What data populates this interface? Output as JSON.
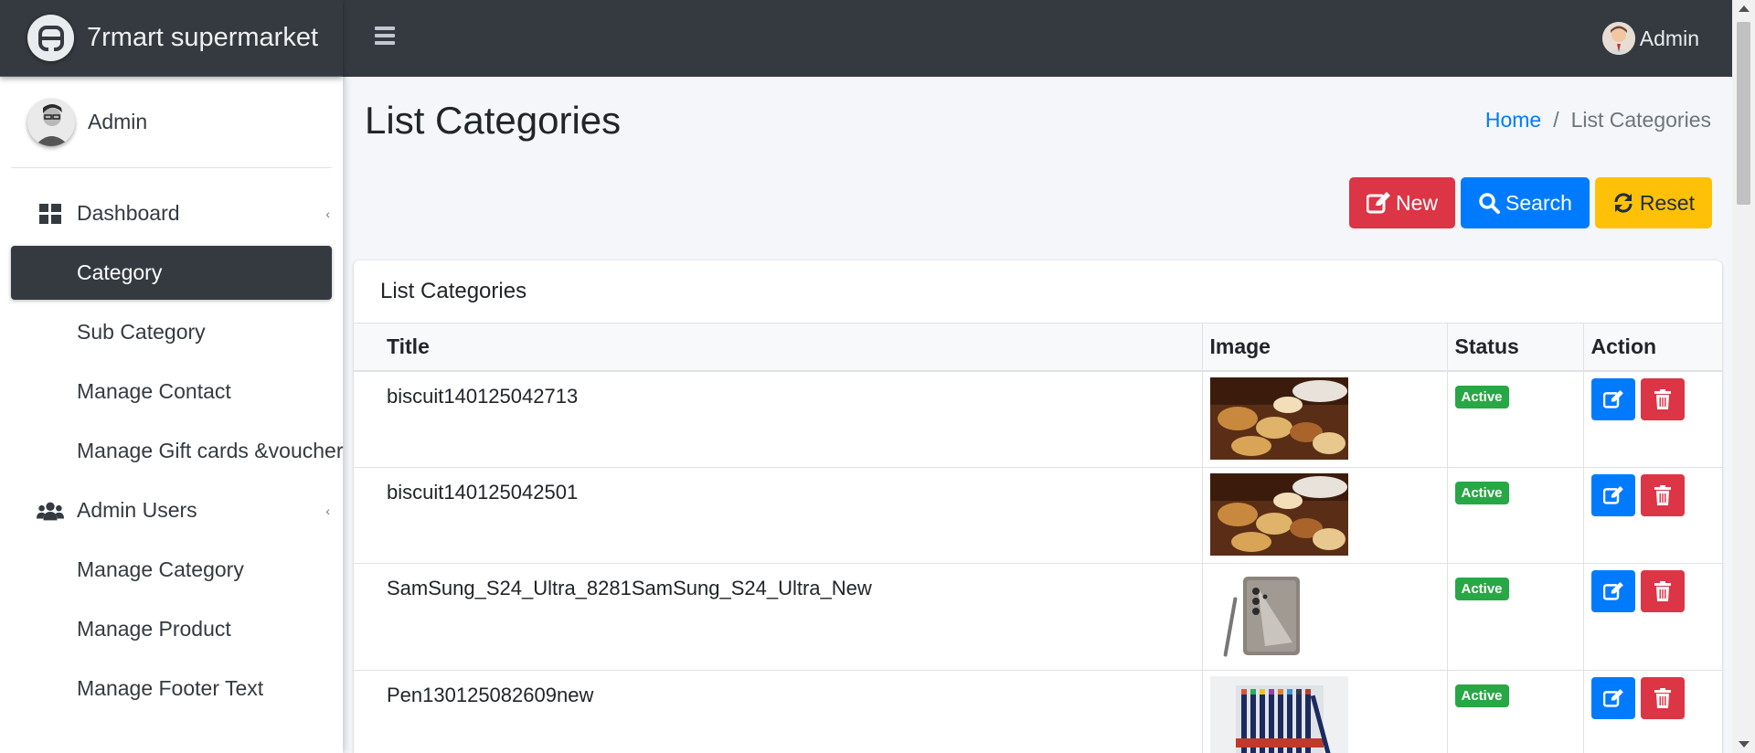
{
  "brand": {
    "name": "7rmart supermarket"
  },
  "header": {
    "user_name": "Admin"
  },
  "sidebar": {
    "user_name": "Admin",
    "items": [
      {
        "label": "Dashboard",
        "icon": "dashboard-icon"
      },
      {
        "label": "Category"
      },
      {
        "label": "Sub Category"
      },
      {
        "label": "Manage Contact"
      },
      {
        "label": "Manage Gift cards &voucher"
      },
      {
        "label": "Admin Users",
        "icon": "users-icon"
      },
      {
        "label": "Manage Category"
      },
      {
        "label": "Manage Product"
      },
      {
        "label": "Manage Footer Text"
      }
    ],
    "active_item": "Category"
  },
  "page": {
    "title": "List Categories",
    "breadcrumb": {
      "home": "Home",
      "current": "List Categories"
    }
  },
  "toolbar": {
    "new_label": "New",
    "search_label": "Search",
    "reset_label": "Reset"
  },
  "card": {
    "title": "List Categories",
    "columns": [
      "Title",
      "Image",
      "Status",
      "Action"
    ],
    "rows": [
      {
        "title": "biscuit140125042713",
        "image": "biscuits-image",
        "status": "Active"
      },
      {
        "title": "biscuit140125042501",
        "image": "biscuits-image",
        "status": "Active"
      },
      {
        "title": "SamSung_S24_Ultra_8281SamSung_S24_Ultra_New",
        "image": "phone-image",
        "status": "Active"
      },
      {
        "title": "Pen130125082609new",
        "image": "pens-image",
        "status": "Active"
      }
    ]
  },
  "colors": {
    "navbar": "#343a40",
    "primary": "#007bff",
    "danger": "#dc3545",
    "warning": "#ffc107",
    "success": "#28a745"
  }
}
